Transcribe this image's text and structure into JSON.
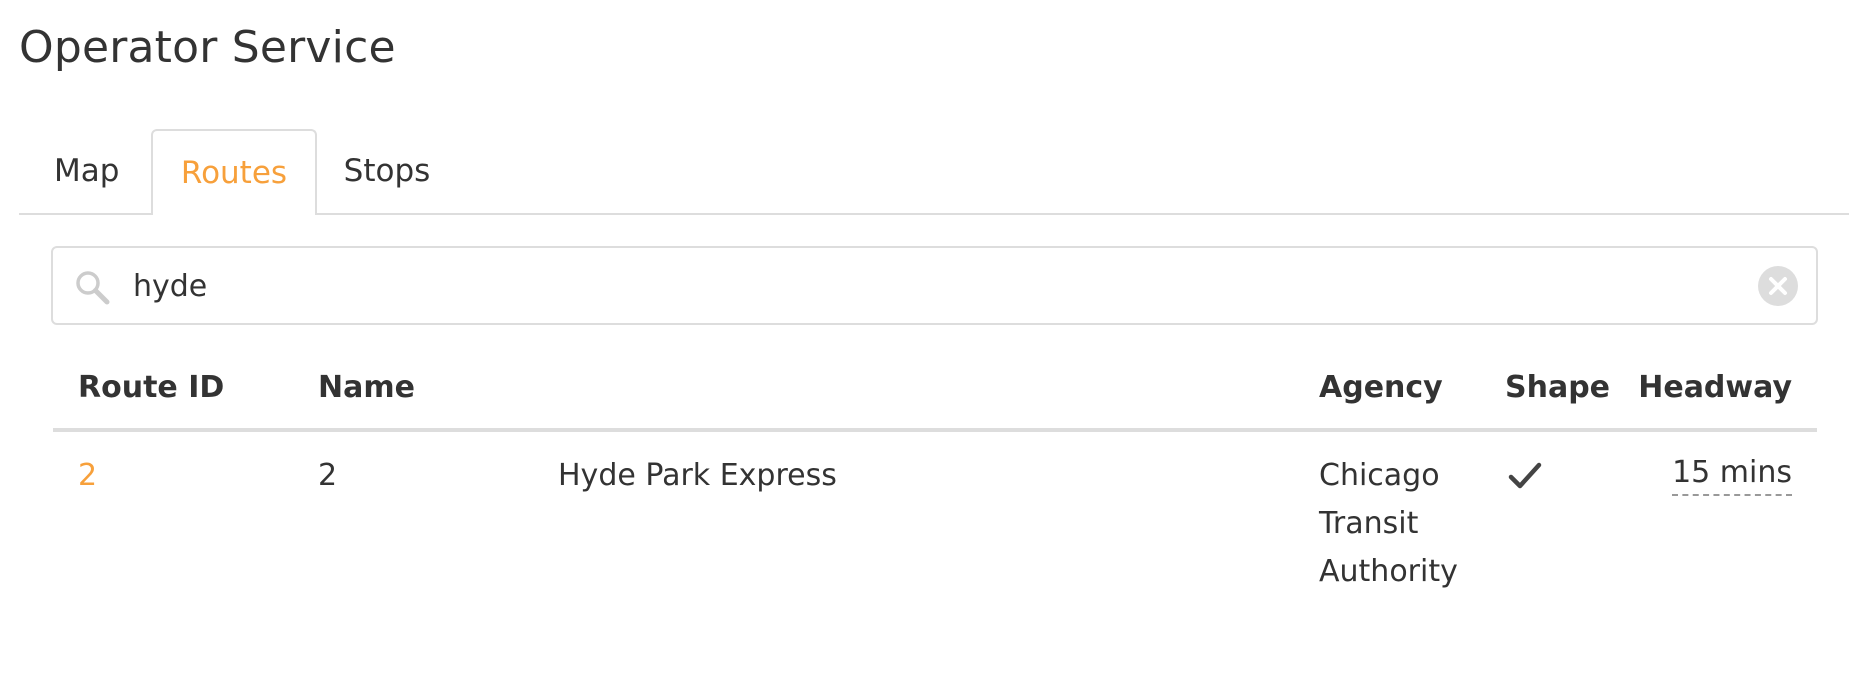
{
  "page": {
    "title": "Operator Service"
  },
  "tabs": [
    {
      "label": "Map",
      "active": false
    },
    {
      "label": "Routes",
      "active": true
    },
    {
      "label": "Stops",
      "active": false
    }
  ],
  "search": {
    "value": "hyde",
    "icon": "search-icon",
    "clear_icon": "clear-icon"
  },
  "table": {
    "headers": {
      "route_id": "Route ID",
      "name": "Name",
      "agency": "Agency",
      "shape": "Shape",
      "headway": "Headway"
    },
    "rows": [
      {
        "route_id": "2",
        "short_name": "2",
        "long_name": "Hyde Park Express",
        "agency": "Chicago Transit Authority",
        "shape_icon": "checkmark-icon",
        "headway": "15 mins"
      }
    ]
  },
  "colors": {
    "accent": "#f7a03b",
    "text": "#333333",
    "border": "#dddddd"
  }
}
